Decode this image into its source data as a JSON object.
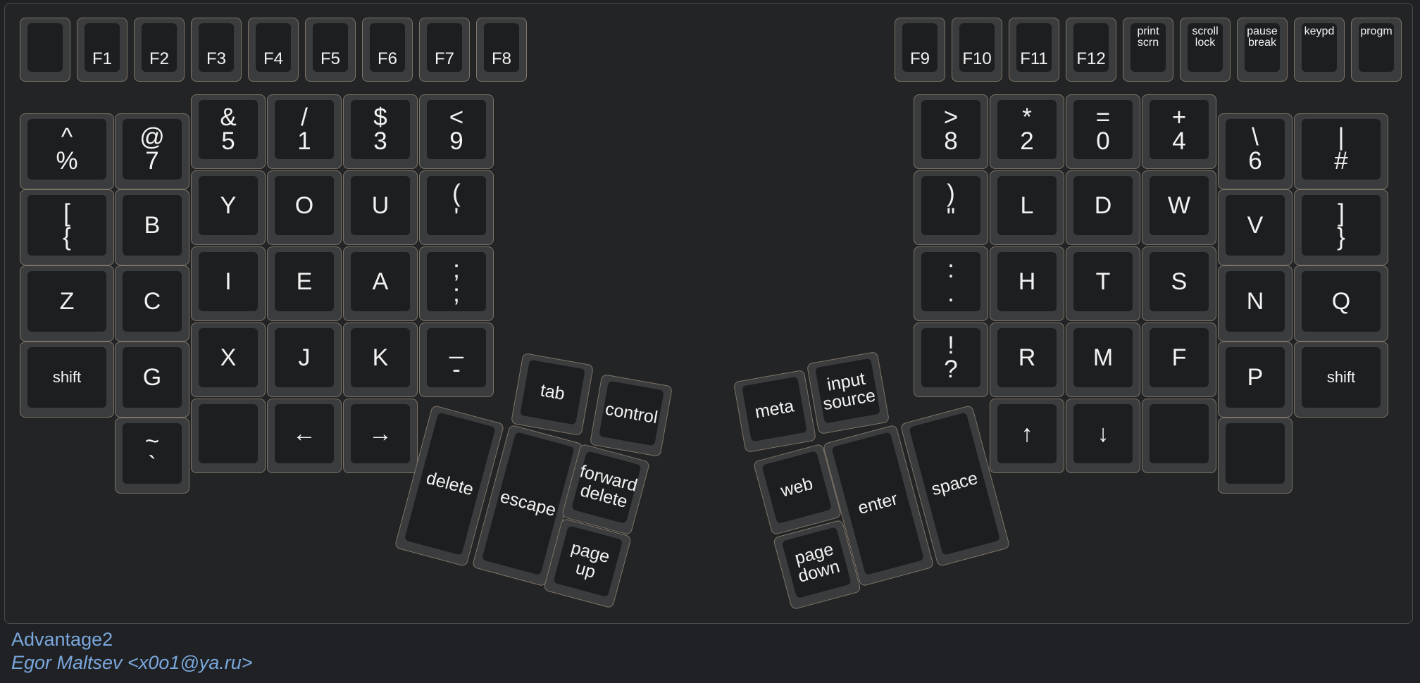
{
  "layout": {
    "name": "Advantage2",
    "author": "Egor Maltsev <x0o1@ya.ru>"
  },
  "colors": {
    "background": "#1f2124",
    "key_base": "#3b3c3e",
    "key_top": "#1d1e20",
    "key_border": "#7b7467",
    "legend": "#f2f2f2",
    "footer_text": "#7aa7dc"
  },
  "keys": {
    "fn_left": [
      "",
      "F1",
      "F2",
      "F3",
      "F4",
      "F5",
      "F6",
      "F7",
      "F8"
    ],
    "fn_right": [
      "F9",
      "F10",
      "F11",
      "F12",
      "print\nscrn",
      "scroll\nlock",
      "pause\nbreak",
      "keypd",
      "progm"
    ],
    "left_outer": [
      "^\n%",
      "[\n{",
      "Z",
      "shift"
    ],
    "left_col2": [
      "@\n7",
      "B",
      "C",
      "G",
      "~\n`"
    ],
    "left_main": [
      [
        "&\n5",
        "/\n1",
        "$\n3",
        "<\n9"
      ],
      [
        "Y",
        "O",
        "U",
        "(\n'"
      ],
      [
        "I",
        "E",
        "A",
        ";\n;"
      ],
      [
        "X",
        "J",
        "K",
        "_\n-"
      ],
      [
        "",
        "←",
        "→"
      ]
    ],
    "right_main": [
      [
        ">\n8",
        "*\n2",
        "=\n0",
        "+\n4"
      ],
      [
        ")\n\"",
        "L",
        "D",
        "W"
      ],
      [
        ":\n.",
        "H",
        "T",
        "S"
      ],
      [
        "!\n?",
        "R",
        "M",
        "F"
      ],
      [
        "↑",
        "↓",
        ""
      ]
    ],
    "right_col1": [
      "\\\n6",
      "V",
      "N",
      "P",
      ""
    ],
    "right_outer": [
      "|\n#",
      "]\n}",
      "Q",
      "shift"
    ],
    "thumb_left": {
      "tab": "tab",
      "control": "control",
      "delete": "delete",
      "escape": "escape",
      "forward_delete": "forward\ndelete",
      "page_up": "page\nup"
    },
    "thumb_right": {
      "meta": "meta",
      "input_source": "input\nsource",
      "web": "web",
      "enter": "enter",
      "space": "space",
      "page_down": "page\ndown"
    }
  }
}
